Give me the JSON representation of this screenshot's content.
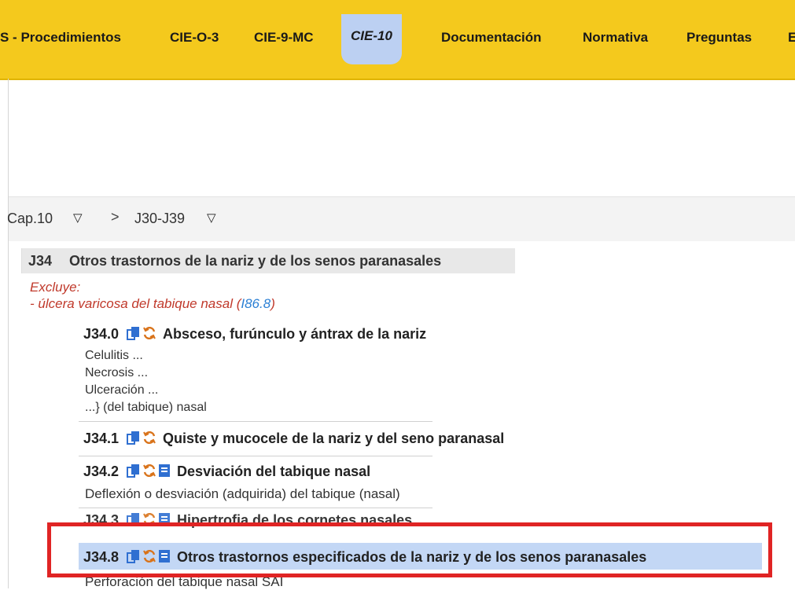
{
  "nav": {
    "tabs": [
      {
        "label": "S - Procedimientos"
      },
      {
        "label": "CIE-O-3"
      },
      {
        "label": "CIE-9-MC"
      },
      {
        "label": "CIE-10"
      },
      {
        "label": "Documentación"
      },
      {
        "label": "Normativa"
      },
      {
        "label": "Preguntas"
      },
      {
        "label": "E"
      }
    ],
    "active_tab": "CIE-10"
  },
  "breadcrumb": {
    "chapter": "Cap.10",
    "separator": ">",
    "range": "J30-J39"
  },
  "category": {
    "code": "J34",
    "title": "Otros trastornos de la nariz y de los senos paranasales",
    "excludes_label": "Excluye:",
    "excludes_text": "- úlcera varicosa del tabique nasal (",
    "excludes_code": "I86.8",
    "excludes_close": ")"
  },
  "items": [
    {
      "code": "J34.0",
      "title": "Absceso, furúnculo y ántrax de la nariz",
      "sub": [
        "Celulitis ...",
        "Necrosis ...",
        "Ulceración ...",
        "...} (del tabique) nasal"
      ]
    },
    {
      "code": "J34.1",
      "title": "Quiste y mucocele de la nariz y del seno paranasal"
    },
    {
      "code": "J34.2",
      "title": "Desviación del tabique nasal",
      "sub": [
        "Deflexión o desviación (adquirida) del tabique (nasal)"
      ]
    },
    {
      "code": "J34.3",
      "title": "Hipertrofia de los cornetes nasales"
    },
    {
      "code": "J34.8",
      "title": "Otros trastornos especificados de la nariz y de los senos paranasales",
      "sub": [
        "Perforación del tabique nasal SAI"
      ]
    }
  ],
  "icons": {
    "copy": "copy-icon",
    "refresh": "refresh-icon",
    "note": "note-icon"
  },
  "colors": {
    "nav_bg": "#f4c91d",
    "active_tab_bg": "#bcd0f2",
    "selected_row_bg": "#c3d7f5",
    "exclusion_text": "#c0392b",
    "link": "#2a7fd4",
    "highlight_box": "#e02424"
  }
}
